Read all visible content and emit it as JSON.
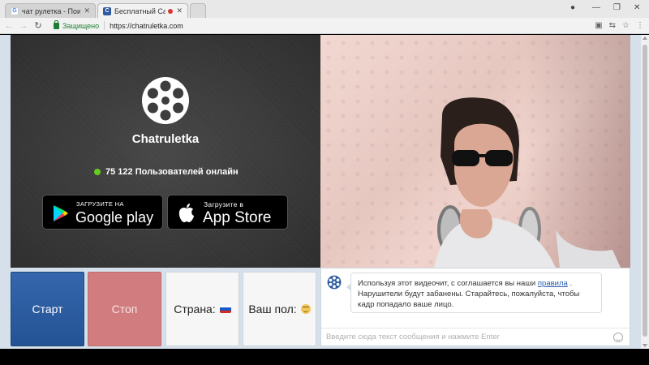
{
  "browser": {
    "tabs": [
      {
        "title": "чат рулетка - Поиск в G",
        "favicon": "G",
        "favicon_color": "#4285f4",
        "active": false
      },
      {
        "title": "Бесплатный Cam Cha",
        "favicon": "C",
        "favicon_color": "#2c5aa0",
        "active": true
      }
    ],
    "security_label": "Защищено",
    "url": "https://chatruletka.com"
  },
  "brand": {
    "name": "Chatruletka",
    "online_count": "75 122",
    "online_label": "Пользователей онлайн",
    "online_color": "#66cc22"
  },
  "stores": {
    "google_sub": "ЗАГРУЗИТЕ НА",
    "google_big": "Google play",
    "apple_sub": "Загрузите в",
    "apple_big": "App Store"
  },
  "controls": {
    "start_label": "Старт",
    "stop_label": "Стоп",
    "country_label": "Страна:",
    "gender_label": "Ваш пол:",
    "start_color": "#2d5ea3",
    "stop_color": "#d17d80"
  },
  "chat": {
    "notice_prefix": "Используя этот видеочит, с соглашается вы наши",
    "notice_link": "правила",
    "notice_suffix": ". Нарушители будут забанены. Старайтесь, пожалуйста, чтобы кадр попадало ваше лицо.",
    "input_placeholder": "Введите сюда текст сообщения и нажмите Enter"
  }
}
